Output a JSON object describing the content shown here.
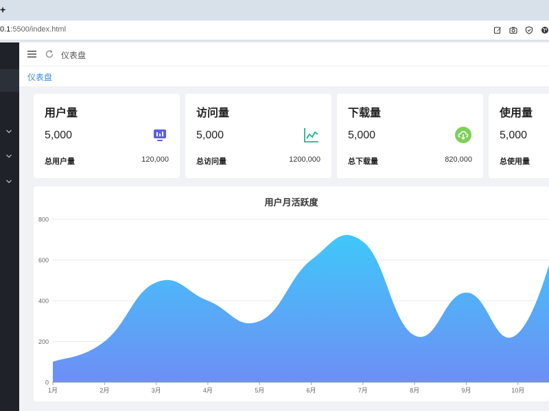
{
  "browser": {
    "new_tab_glyph": "+",
    "url_host": "0.1",
    "url_rest": ":5500/index.html",
    "toolbar_icons": [
      "edit-icon",
      "camera-icon",
      "shield-icon",
      "globe-icon"
    ]
  },
  "header": {
    "breadcrumb": "仪表盘",
    "active_tag": "仪表盘"
  },
  "colors": {
    "sidebar": "#1f2229",
    "accent": "#3b8be8",
    "area_top": "#33d7fa",
    "area_bottom": "#6e8ef5"
  },
  "stats": [
    {
      "title": "用户量",
      "value": "5,000",
      "footer_label": "总用户量",
      "footer_value": "120,000",
      "icon": "monitor-chart-icon",
      "icon_color": "#5b5fe6"
    },
    {
      "title": "访问量",
      "value": "5,000",
      "footer_label": "总访问量",
      "footer_value": "1200,000",
      "icon": "line-trend-icon",
      "icon_color": "#1fb58a"
    },
    {
      "title": "下载量",
      "value": "5,000",
      "footer_label": "总下载量",
      "footer_value": "820,000",
      "icon": "cloud-download-icon",
      "icon_color": "#7fd05a"
    },
    {
      "title": "使用量",
      "value": "5,000",
      "footer_label": "总使用量",
      "footer_value": "",
      "icon": "",
      "icon_color": ""
    }
  ],
  "chart_data": {
    "type": "area",
    "title": "用户月活跃度",
    "categories": [
      "1月",
      "2月",
      "3月",
      "4月",
      "5月",
      "6月",
      "7月",
      "8月",
      "9月",
      "10月"
    ],
    "series": [
      {
        "values": [
          100,
          200,
          490,
          400,
          300,
          600,
          690,
          230,
          440,
          240
        ]
      }
    ],
    "ylim": [
      0,
      800
    ],
    "yticks": [
      0,
      200,
      400,
      600,
      800
    ],
    "grid": true
  }
}
